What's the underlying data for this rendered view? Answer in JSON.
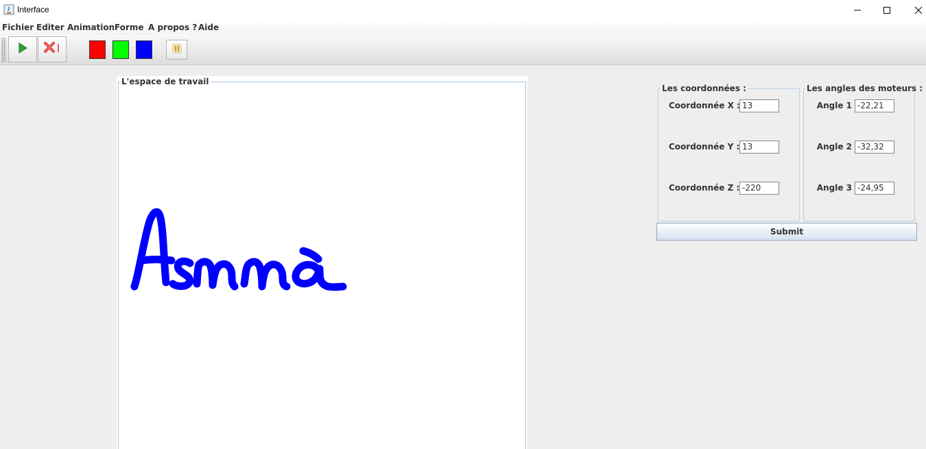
{
  "window": {
    "title": "Interface"
  },
  "menu": {
    "items": [
      "Fichier",
      "Editer",
      "Animation",
      "Forme",
      "A propos ?",
      "Aide"
    ]
  },
  "toolbar": {
    "icons": [
      "play-icon",
      "stop-icon",
      "pause-icon"
    ],
    "colors": [
      "#ff0000",
      "#00ff00",
      "#0000ff"
    ]
  },
  "workspace": {
    "title": "L'espace de travail",
    "stroke_color": "#0000ff"
  },
  "coords": {
    "title": "Les coordonnées :",
    "x_label": "Coordonnée X :",
    "x_value": "13",
    "y_label": "Coordonnée Y :",
    "y_value": "13",
    "z_label": "Coordonnée Z :",
    "z_value": "-220"
  },
  "angles": {
    "title": "Les angles des moteurs :",
    "a1_label": "Angle 1",
    "a1_value": "-22,21",
    "a2_label": "Angle 2",
    "a2_value": "-32,32",
    "a3_label": "Angle 3",
    "a3_value": "-24,95"
  },
  "submit_label": "Submit"
}
